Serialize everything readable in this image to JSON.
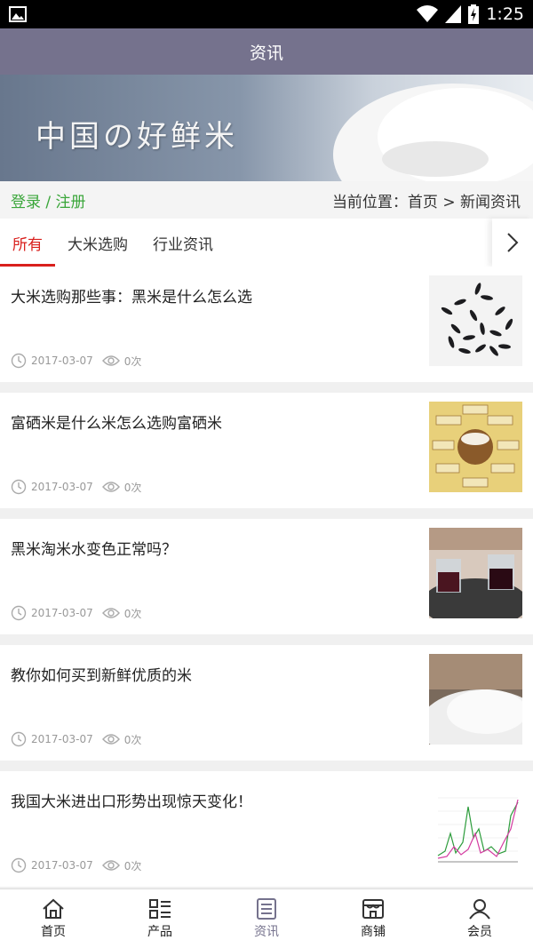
{
  "status": {
    "time": "1:25"
  },
  "appbar": {
    "title": "资讯"
  },
  "banner": {
    "title": "中国の好鲜米"
  },
  "locbar": {
    "login": "登录 / 注册",
    "location": "当前位置：首页 > 新闻资讯"
  },
  "tabs": [
    {
      "label": "所有"
    },
    {
      "label": "大米选购"
    },
    {
      "label": "行业资讯"
    }
  ],
  "articles": [
    {
      "title": "大米选购那些事：黑米是什么怎么选",
      "date": "2017-03-07",
      "views": "0次",
      "thumb": "black-rice-photo"
    },
    {
      "title": "富硒米是什么米怎么选购富硒米",
      "date": "2017-03-07",
      "views": "0次",
      "thumb": "selenium-rice-diagram"
    },
    {
      "title": "黑米淘米水变色正常吗？",
      "date": "2017-03-07",
      "views": "0次",
      "thumb": "black-rice-water-photo"
    },
    {
      "title": "教你如何买到新鲜优质的米",
      "date": "2017-03-07",
      "views": "0次",
      "thumb": "white-rice-photo"
    },
    {
      "title": "我国大米进出口形势出现惊天变化！",
      "date": "2017-03-07",
      "views": "0次",
      "thumb": "rice-trade-chart"
    }
  ],
  "bottomnav": [
    {
      "label": "首页",
      "icon": "home-icon"
    },
    {
      "label": "产品",
      "icon": "list-icon"
    },
    {
      "label": "资讯",
      "icon": "news-icon",
      "active": true
    },
    {
      "label": "商铺",
      "icon": "shop-icon"
    },
    {
      "label": "会员",
      "icon": "user-icon"
    }
  ],
  "colors": {
    "appbar": "#75728d",
    "active_tab": "#d9201d",
    "login": "#3aa63a"
  }
}
